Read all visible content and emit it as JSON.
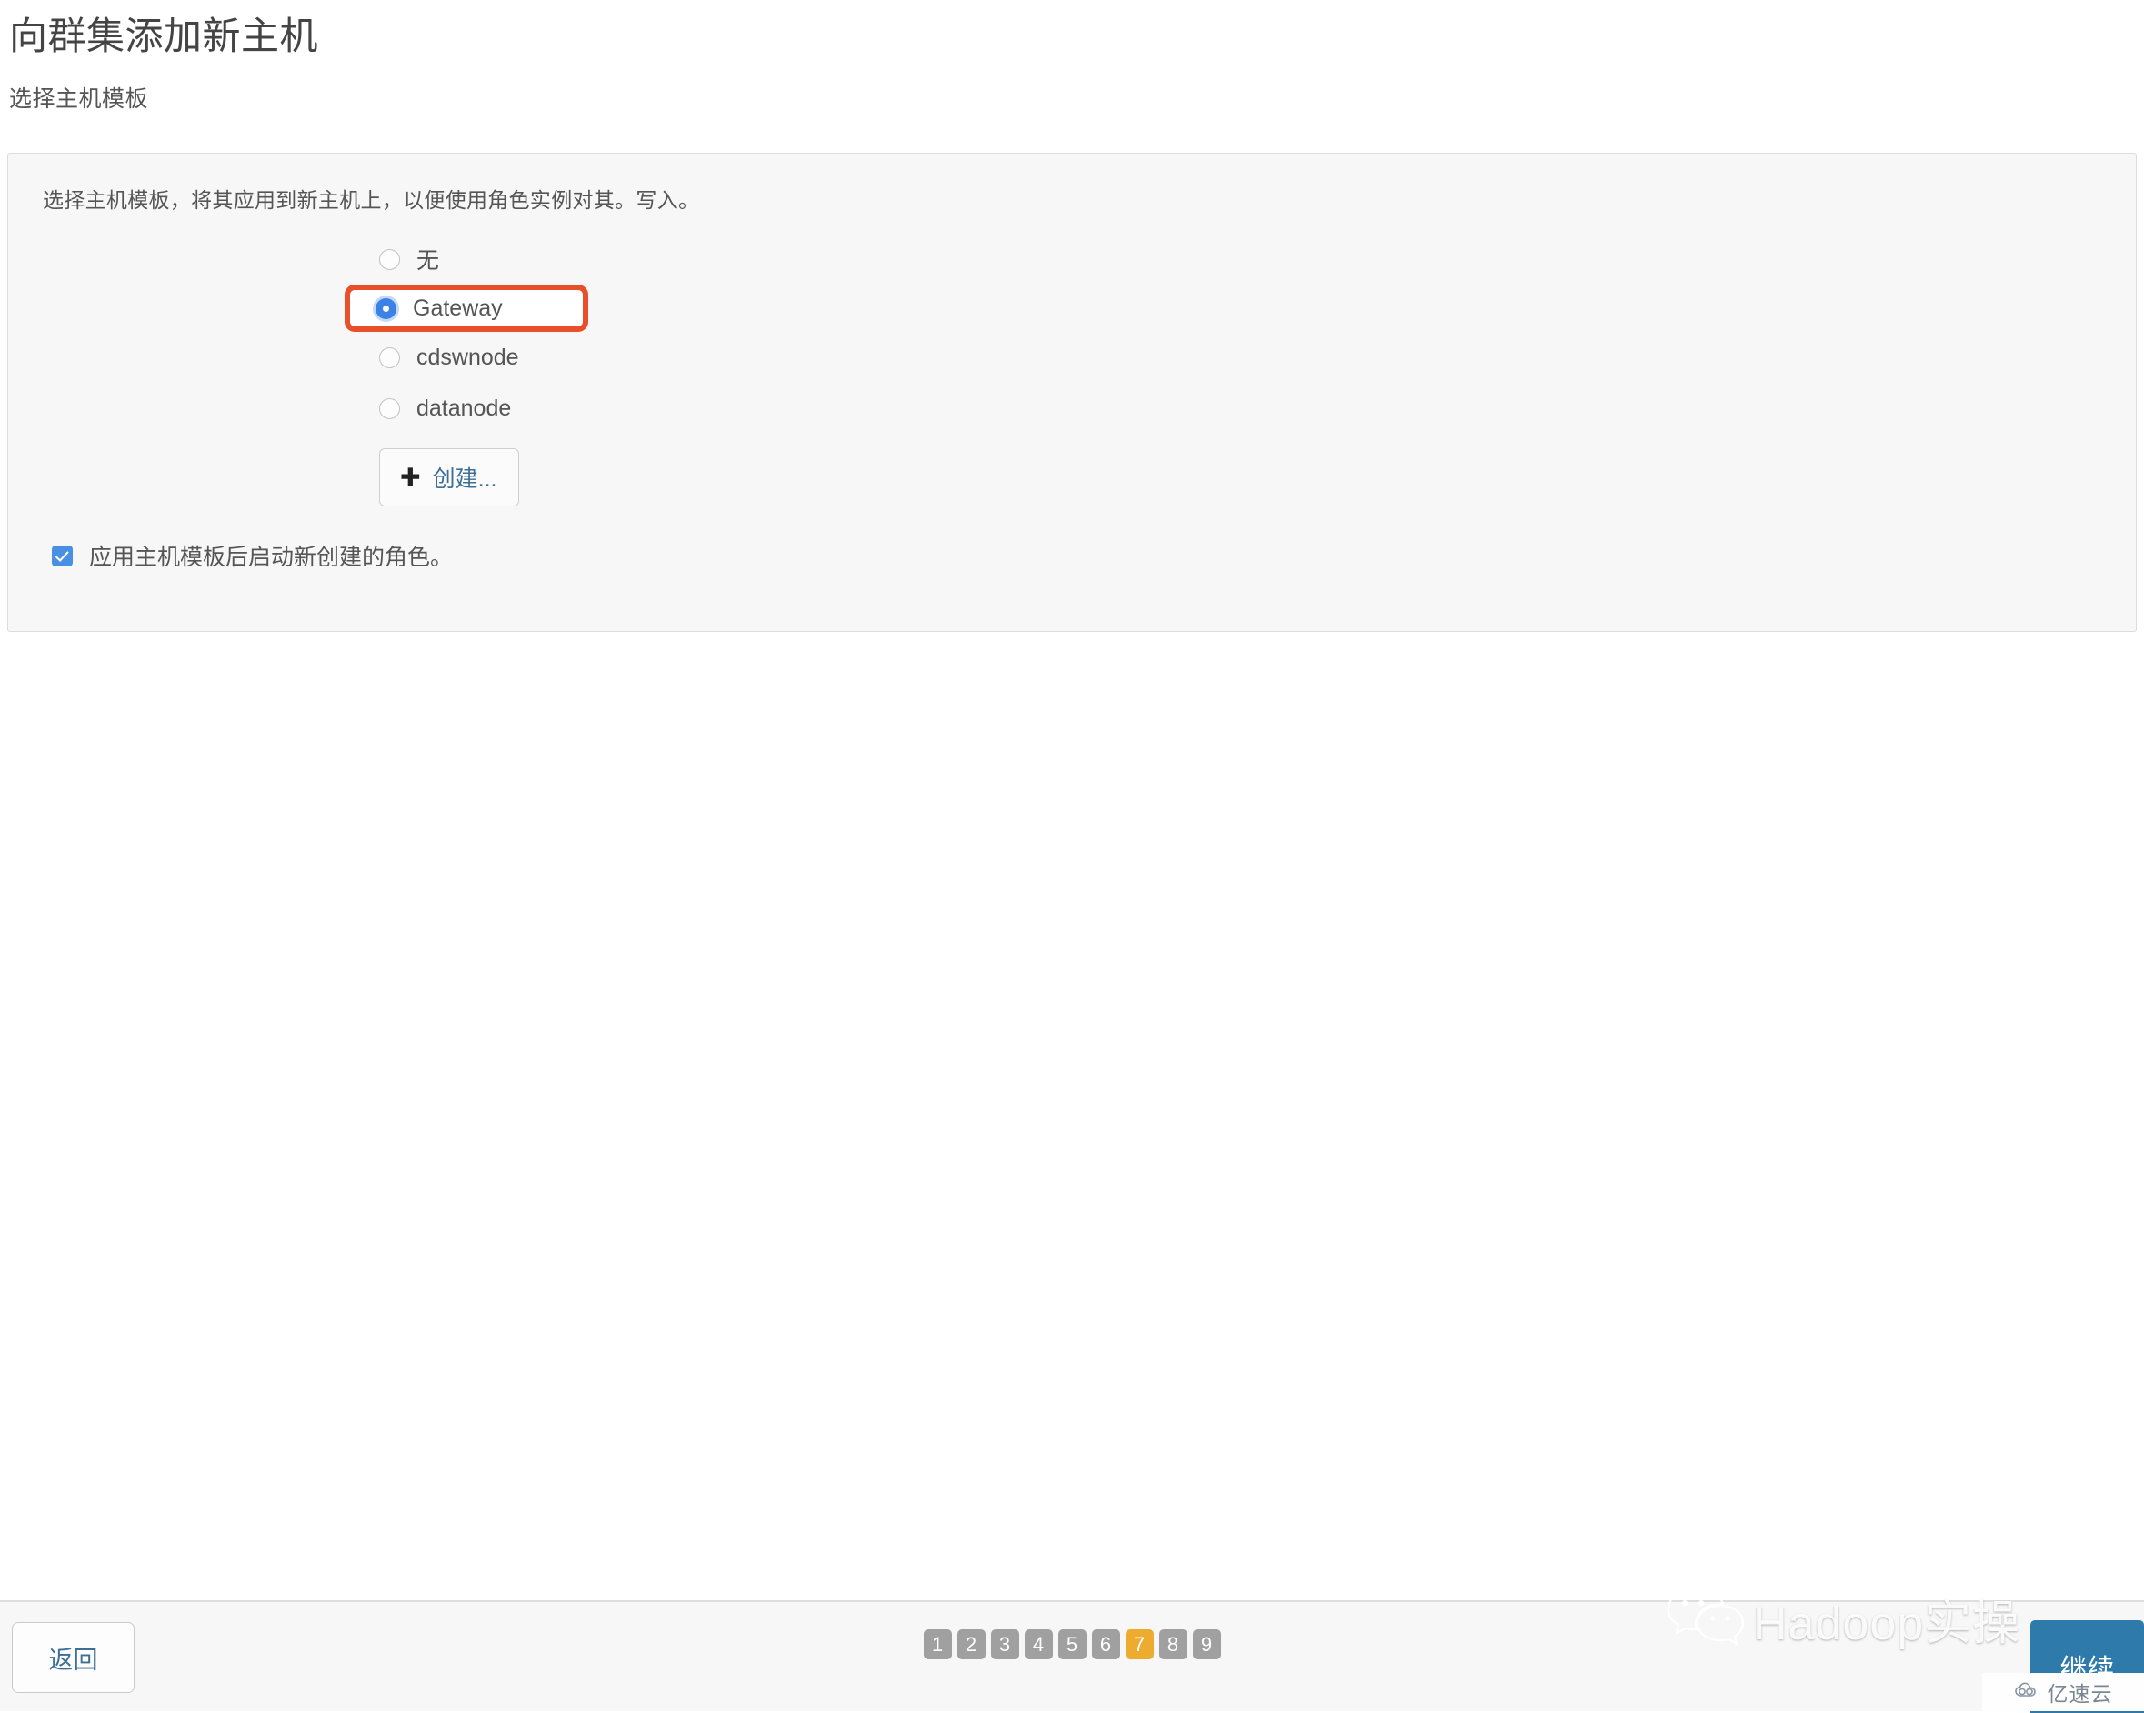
{
  "header": {
    "title": "向群集添加新主机",
    "subtitle": "选择主机模板"
  },
  "panel": {
    "description": "选择主机模板，将其应用到新主机上，以便使用角色实例对其。写入。",
    "radio_group": {
      "name": "host-template",
      "selected": "Gateway",
      "options": [
        {
          "label": "无",
          "checked": false,
          "highlighted": false
        },
        {
          "label": "Gateway",
          "checked": true,
          "highlighted": true
        },
        {
          "label": "cdswnode",
          "checked": false,
          "highlighted": false
        },
        {
          "label": "datanode",
          "checked": false,
          "highlighted": false
        }
      ]
    },
    "create_button": {
      "icon": "plus-icon",
      "label": "创建..."
    },
    "checkbox": {
      "label": "应用主机模板后启动新创建的角色。",
      "checked": true
    }
  },
  "footer": {
    "back_label": "返回",
    "continue_label": "继续",
    "pagination": {
      "steps": [
        "1",
        "2",
        "3",
        "4",
        "5",
        "6",
        "7",
        "8",
        "9"
      ],
      "active": "7"
    }
  },
  "watermark": {
    "icon": "wechat-icon",
    "text": "Hadoop实操"
  },
  "badge": {
    "icon": "cloud-icon",
    "text": "亿速云"
  },
  "colors": {
    "highlight_border": "#e8502a",
    "radio_selected": "#3b82e8",
    "checkbox": "#4a90e2",
    "active_step": "#edab30",
    "continue_bg": "#2e7aab",
    "link_text": "#3d6f96",
    "panel_bg": "#f7f7f7"
  }
}
